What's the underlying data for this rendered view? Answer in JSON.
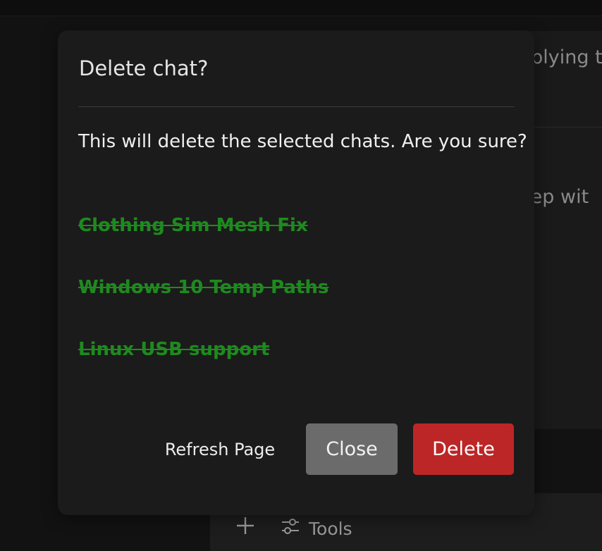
{
  "background": {
    "line_1_fragment": "pplying t",
    "line_2_fragment": "step wit"
  },
  "composer": {
    "add_icon": "plus-icon",
    "tools_icon": "sliders-icon",
    "tools_label": "Tools"
  },
  "dialog": {
    "title": "Delete chat?",
    "message": "This will delete the selected chats. Are you sure?",
    "chats": [
      "Clothing Sim Mesh Fix",
      "Windows 10 Temp Paths",
      "Linux USB support"
    ],
    "buttons": {
      "refresh": "Refresh Page",
      "close": "Close",
      "delete": "Delete"
    }
  },
  "colors": {
    "chat_item": "#1e8a1e",
    "delete_button": "#bd2626",
    "close_button": "#6b6b6b",
    "dialog_bg": "#1b1b1b"
  }
}
